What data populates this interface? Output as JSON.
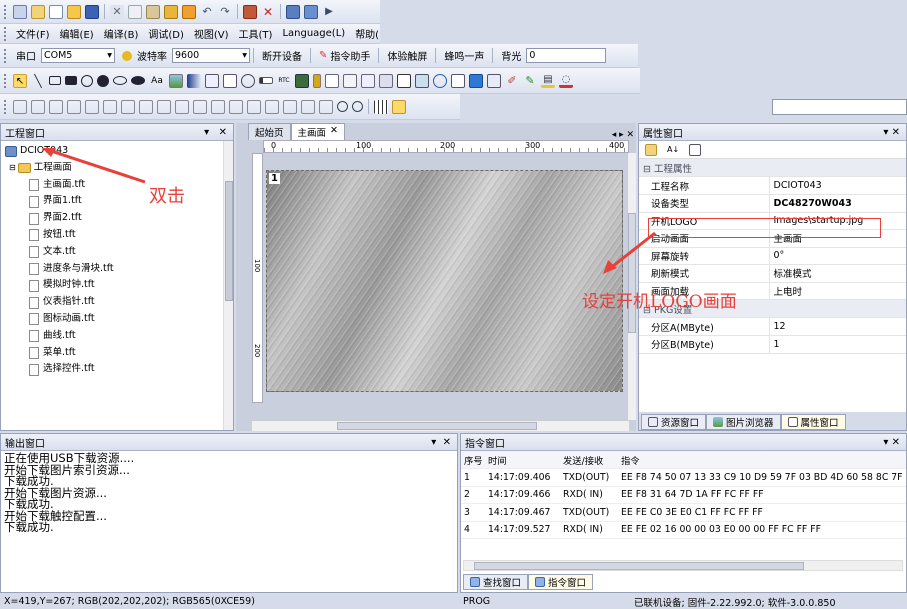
{
  "menu": [
    "文件(F)",
    "编辑(E)",
    "编译(B)",
    "调试(D)",
    "视图(V)",
    "工具(T)",
    "Language(L)",
    "帮助(H)"
  ],
  "toolbar2": {
    "port_label": "串口",
    "port_value": "COM5",
    "baud_label": "波特率",
    "baud_value": "9600",
    "open_label": "断开设备",
    "cmd_label": "指令助手",
    "touch_label": "体验触屏",
    "beep_label": "蜂鸣一声",
    "backlight_label": "背光",
    "backlight_value": "0"
  },
  "project": {
    "title": "工程窗口",
    "root": "DCIOT043",
    "folder": "工程画面",
    "files": [
      "主画面.tft",
      "界面1.tft",
      "界面2.tft",
      "按钮.tft",
      "文本.tft",
      "进度条与滑块.tft",
      "模拟时钟.tft",
      "仪表指针.tft",
      "图标动画.tft",
      "曲线.tft",
      "菜单.tft",
      "选择控件.tft"
    ]
  },
  "annotations": {
    "double_click": "双击",
    "set_logo": "设定开机LOGO画面"
  },
  "editor": {
    "tabs": [
      "起始页",
      "主画面"
    ],
    "ruler": [
      "0",
      "100",
      "200",
      "300",
      "400"
    ],
    "ruler_v": [
      "100",
      "200"
    ],
    "screen_number": "1"
  },
  "props": {
    "title": "属性窗口",
    "group1": "工程属性",
    "rows": [
      {
        "k": "工程名称",
        "v": "DCIOT043"
      },
      {
        "k": "设备类型",
        "v": "DC48270W043"
      },
      {
        "k": "开机LOGO",
        "v": "Images\\startup.jpg"
      },
      {
        "k": "启动画面",
        "v": "主画面"
      },
      {
        "k": "屏幕旋转",
        "v": "0°"
      },
      {
        "k": "刷新模式",
        "v": "标准模式"
      },
      {
        "k": "画面加载",
        "v": "上电时"
      }
    ],
    "group2": "PKG设置",
    "rows2": [
      {
        "k": "分区A(MByte)",
        "v": "12"
      },
      {
        "k": "分区B(MByte)",
        "v": "1"
      }
    ],
    "tabs": [
      "资源窗口",
      "图片浏览器",
      "属性窗口"
    ]
  },
  "output": {
    "title": "输出窗口",
    "lines": [
      "正在使用USB下载资源....",
      "开始下载图片索引资源...",
      "下载成功.",
      "开始下载图片资源...",
      "下载成功.",
      "开始下载触控配置...",
      "下载成功."
    ]
  },
  "commands": {
    "title": "指令窗口",
    "headers": [
      "序号",
      "时间",
      "发送/接收",
      "指令"
    ],
    "rows": [
      {
        "n": "1",
        "t": "14:17:09.406",
        "d": "TXD(OUT)",
        "c": "EE F8 74 50 07 13 33 C9 10 D9 59 7F 03 BD 4D 60 58 8C 7F"
      },
      {
        "n": "2",
        "t": "14:17:09.466",
        "d": "RXD( IN)",
        "c": "EE F8 31 64 7D 1A FF FC FF FF"
      },
      {
        "n": "3",
        "t": "14:17:09.467",
        "d": "TXD(OUT)",
        "c": "EE FE C0 3E E0 C1 FF FC FF FF"
      },
      {
        "n": "4",
        "t": "14:17:09.527",
        "d": "RXD( IN)",
        "c": "EE FE 02 16 00 00 03 E0 00 00 FF FC FF FF"
      }
    ],
    "tabs": [
      "查找窗口",
      "指令窗口"
    ]
  },
  "status": {
    "coords": "X=419,Y=267; RGB(202,202,202); RGB565(0XCE59)",
    "mode": "PROG",
    "device": "已联机设备; 固件-2.22.992.0; 软件-3.0.0.850"
  },
  "colors": {
    "annotation_red": "#e8403a",
    "window_bg": "#d6dbe9"
  }
}
